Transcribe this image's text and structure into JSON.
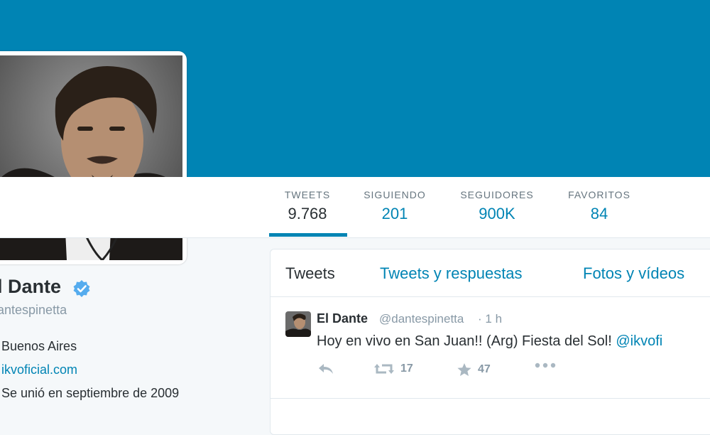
{
  "profile": {
    "name": "El Dante",
    "name_visible": "l Dante",
    "handle_visible": "antespinetta",
    "location": "Buenos Aires",
    "website_visible": "ikvoficial.com",
    "joined": "Se unió en septiembre de 2009"
  },
  "stats": [
    {
      "label": "TWEETS",
      "value": "9.768",
      "active": true
    },
    {
      "label": "SIGUIENDO",
      "value": "201"
    },
    {
      "label": "SEGUIDORES",
      "value": "900K"
    },
    {
      "label": "FAVORITOS",
      "value": "84"
    }
  ],
  "tabs": [
    {
      "label": "Tweets",
      "active": true
    },
    {
      "label": "Tweets y respuestas"
    },
    {
      "label": "Fotos y vídeos"
    }
  ],
  "tweet": {
    "author": "El Dante",
    "handle": "@dantespinetta",
    "separator": "·",
    "time": "1 h",
    "text": "Hoy en vivo en San Juan!! (Arg) Fiesta del Sol!",
    "mention_visible": "@ikvofi",
    "retweets": "17",
    "favorites": "47"
  },
  "icons": {
    "reply": "reply-icon",
    "retweet": "retweet-icon",
    "favorite": "star-icon",
    "more": "more-icon",
    "verified": "verified-badge-icon",
    "location": "location-icon",
    "link": "link-icon",
    "calendar": "calendar-icon"
  },
  "colors": {
    "banner": "#0084b4",
    "link": "#0084b4",
    "text": "#292f33",
    "muted": "#8899a6"
  }
}
